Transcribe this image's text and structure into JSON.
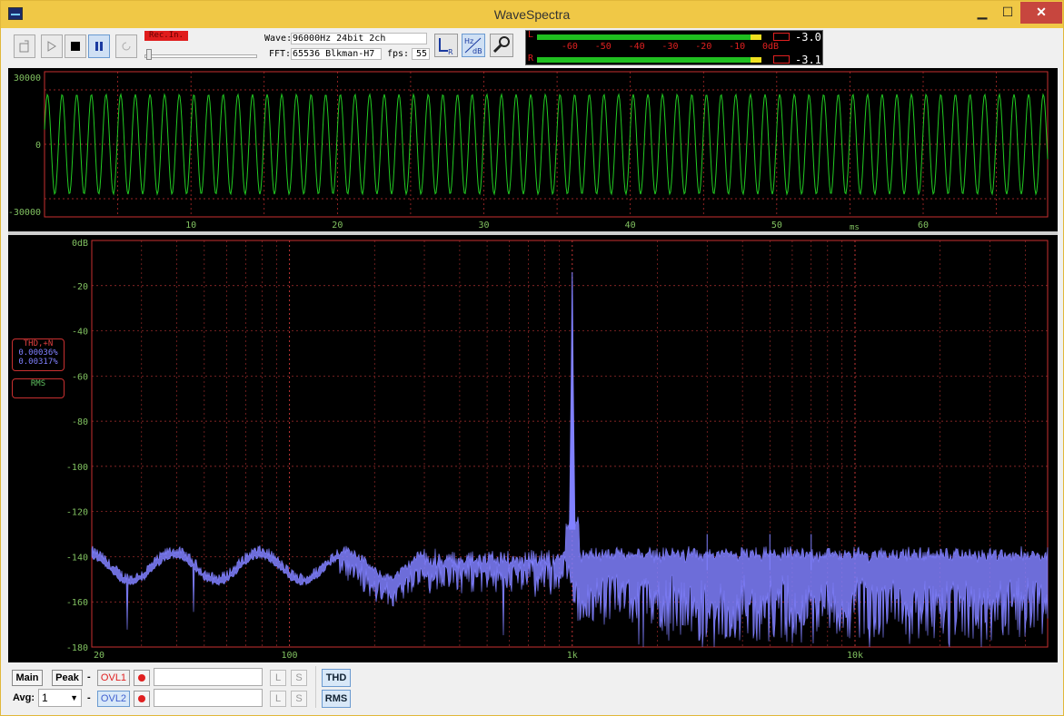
{
  "window": {
    "title": "WaveSpectra",
    "minimize": "▁",
    "maximize": "☐",
    "close": "✕"
  },
  "toolbar": {
    "rec_indicator": "Rec.In.",
    "wave_label": "Wave:",
    "wave_value": "96000Hz 24bit 2ch",
    "fft_label": "FFT:",
    "fft_value": "65536 Blkman-H7",
    "fps_label": "fps:",
    "fps_value": "55"
  },
  "level_meter": {
    "left_channel": "L",
    "right_channel": "R",
    "scale": [
      "-60",
      "-50",
      "-40",
      "-30",
      "-20",
      "-10",
      "0dB"
    ],
    "left_value": "-3.0",
    "right_value": "-3.1",
    "left_level_db": -3.0,
    "right_level_db": -3.1,
    "colors": {
      "green": "#1fbf1f",
      "yellow": "#f0e020",
      "red": "#e02020"
    }
  },
  "waveform": {
    "y_ticks": [
      "30000",
      "0",
      "-30000"
    ],
    "x_ticks": [
      "10",
      "20",
      "30",
      "40",
      "50",
      "60"
    ],
    "x_unit": "ms",
    "colors": {
      "trace": "#22cc22",
      "frame": "#c83030",
      "grid": "#c83030"
    }
  },
  "spectrum": {
    "y_ticks": [
      "0dB",
      "-20",
      "-40",
      "-60",
      "-80",
      "-100",
      "-120",
      "-140",
      "-160",
      "-180"
    ],
    "x_ticks": [
      "20",
      "100",
      "1k",
      "10k"
    ],
    "thd_title": "THD,+N",
    "thd_value": "0.00036%",
    "thdn_value": "0.00317%",
    "rms_title": "RMS",
    "peak_frequency": "1k",
    "colors": {
      "trace": "#8080ff",
      "frame": "#c83030",
      "grid": "#b03030",
      "labels": "#80c060"
    }
  },
  "bottom": {
    "main_label": "Main",
    "peak_label": "Peak",
    "dash1": "-",
    "dash2": "-",
    "ovl1_label": "OVL1",
    "ovl2_label": "OVL2",
    "avg_label": "Avg:",
    "avg_value": "1",
    "l_label": "L",
    "s_label": "S",
    "thd_button": "THD",
    "rms_button": "RMS"
  }
}
